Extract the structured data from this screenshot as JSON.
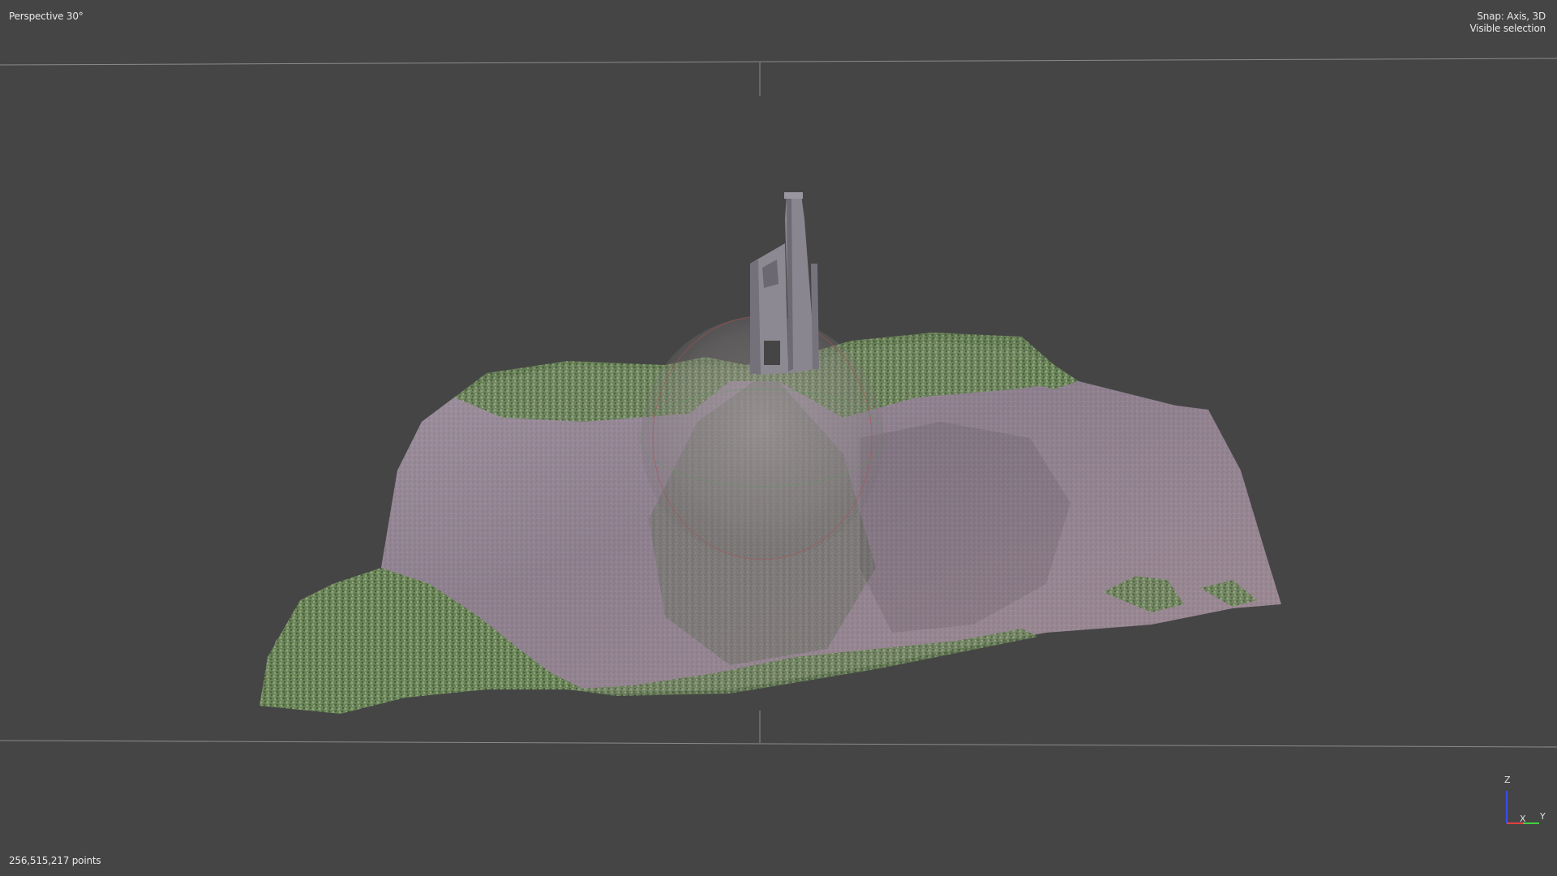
{
  "viewport": {
    "view_mode": "Perspective 30°",
    "snap_mode": "Snap: Axis, 3D",
    "selection_mode": "Visible selection",
    "point_count": "256,515,217 points"
  },
  "axis_gizmo": {
    "z_label": "Z",
    "x_label": "X",
    "y_label": "Y",
    "colors": {
      "z": "#3a4cff",
      "x": "#e04040",
      "y": "#40d040"
    }
  },
  "scene": {
    "object": "point-cloud-hill-with-engine-house-ruin",
    "colors": {
      "background": "#454545",
      "bound_lines": "#8a8a8a",
      "soil": "#9a8a9a",
      "vegetation": "#6e8a5a",
      "stone": "#8a8690",
      "navigation_sphere": "#a09a9a",
      "sphere_ring": "#b05050"
    }
  }
}
